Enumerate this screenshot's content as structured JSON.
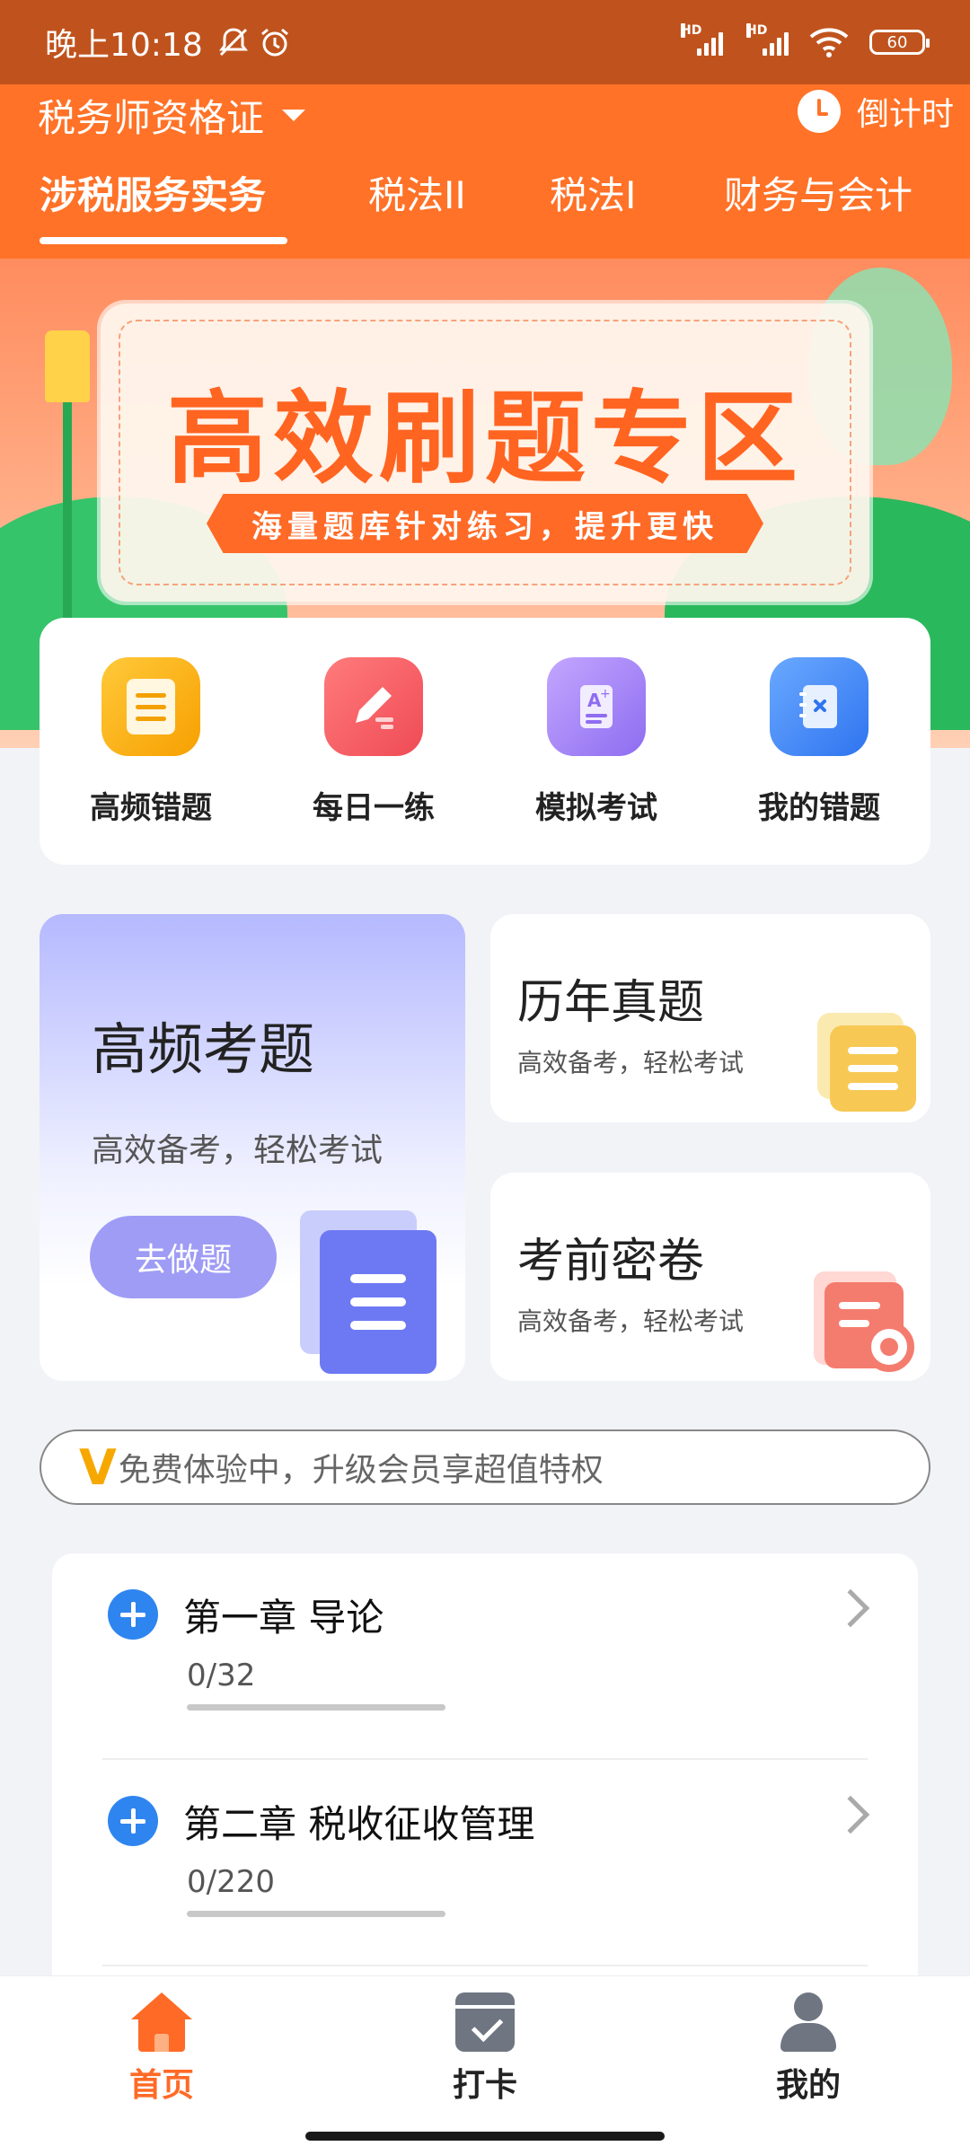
{
  "status_bar": {
    "time": "晚上10:18",
    "icons": [
      "mute-icon",
      "alarm-icon",
      "signal-icon",
      "signal-icon",
      "wifi-icon"
    ],
    "signal_label": "HD",
    "battery": "60"
  },
  "header": {
    "certificate": "税务师资格证",
    "countdown_label": "倒计时",
    "tabs": [
      {
        "label": "涉税服务实务",
        "active": true
      },
      {
        "label": "税法II",
        "active": false
      },
      {
        "label": "税法I",
        "active": false
      },
      {
        "label": "财务与会计",
        "active": false
      }
    ]
  },
  "banner": {
    "title": "高效刷题专区",
    "subtitle": "海量题库针对练习，提升更快"
  },
  "shortcuts": [
    {
      "label": "高频错题",
      "icon": "list-icon",
      "color": "#f7a500"
    },
    {
      "label": "每日一练",
      "icon": "edit-icon",
      "color": "#f2575b"
    },
    {
      "label": "模拟考试",
      "icon": "exam-icon",
      "color": "#9c78f1"
    },
    {
      "label": "我的错题",
      "icon": "notebook-icon",
      "color": "#3f86f5"
    }
  ],
  "features": {
    "big": {
      "title": "高频考题",
      "subtitle": "高效备考，轻松考试",
      "button": "去做题"
    },
    "past": {
      "title": "历年真题",
      "subtitle": "高效备考，轻松考试"
    },
    "secret": {
      "title": "考前密卷",
      "subtitle": "高效备考，轻松考试"
    }
  },
  "vip": {
    "badge": "V",
    "text": "免费体验中，升级会员享超值特权"
  },
  "chapters": [
    {
      "title": "第一章 导论",
      "count": "0/32",
      "progress": 0
    },
    {
      "title": "第二章 税收征收管理",
      "count": "0/220",
      "progress": 0
    }
  ],
  "bottom_nav": [
    {
      "label": "首页",
      "active": true
    },
    {
      "label": "打卡",
      "active": false
    },
    {
      "label": "我的",
      "active": false
    }
  ]
}
